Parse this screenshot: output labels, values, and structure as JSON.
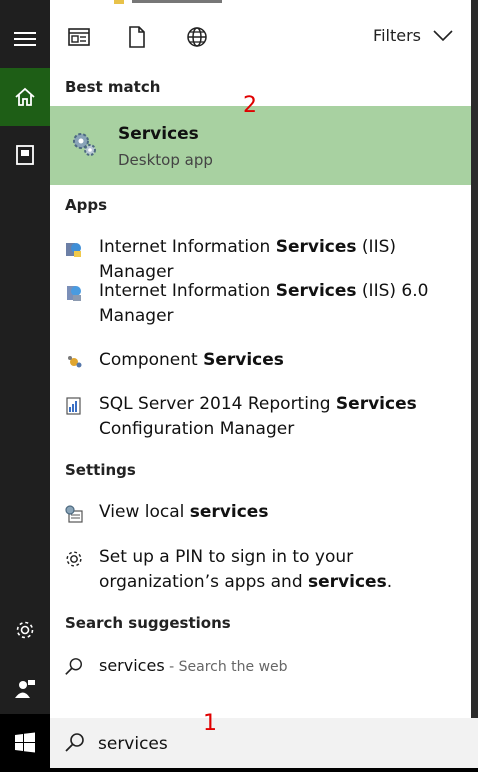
{
  "toolbar": {
    "filters_label": "Filters"
  },
  "sections": {
    "best_match": "Best match",
    "apps": "Apps",
    "settings": "Settings",
    "search_suggestions": "Search suggestions"
  },
  "best_match": {
    "title": "Services",
    "subtitle": "Desktop app"
  },
  "apps": [
    {
      "pre": "Internet Information ",
      "hl": "Services",
      "post": " (IIS) Manager",
      "icon": "iis-manager-icon"
    },
    {
      "pre": "Internet Information ",
      "hl": "Services",
      "post": " (IIS) 6.0 Manager",
      "icon": "iis6-manager-icon"
    },
    {
      "pre": "Component ",
      "hl": "Services",
      "post": "",
      "icon": "component-services-icon"
    },
    {
      "pre": "SQL Server 2014 Reporting ",
      "hl": "Services",
      "post": " Configuration Manager",
      "icon": "sql-reporting-icon"
    }
  ],
  "settings": [
    {
      "pre": "View local ",
      "hl": "services",
      "post": "",
      "icon": "view-services-icon"
    },
    {
      "pre": "Set up a PIN to sign in to your organization’s apps and ",
      "hl": "services",
      "post": ".",
      "icon": "gear-icon"
    }
  ],
  "suggestion": {
    "query": "services",
    "hint": " - Search the web"
  },
  "search": {
    "value": "services"
  },
  "annotations": {
    "one": "1",
    "two": "2"
  }
}
